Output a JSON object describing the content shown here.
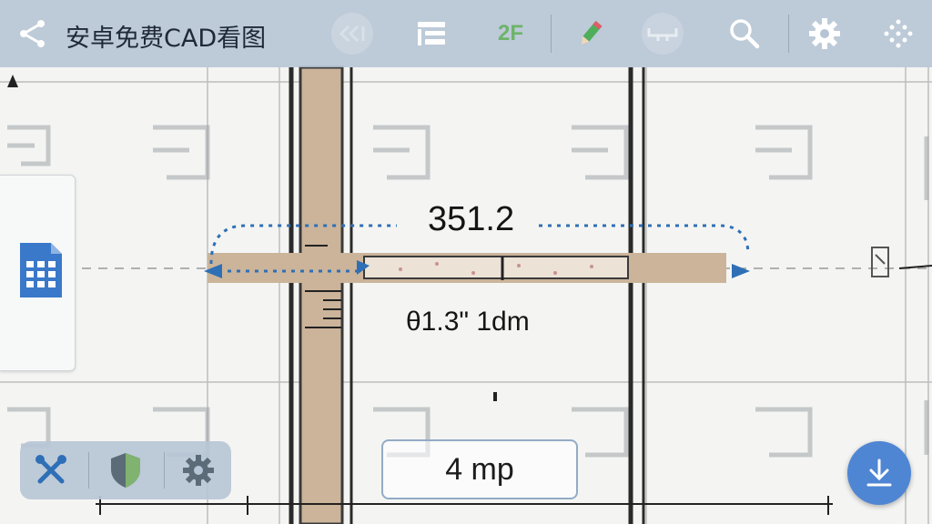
{
  "app": {
    "title": "安卓免费CAD看图"
  },
  "toolbar": {
    "icons": [
      "back-share-icon",
      "rewind-icon",
      "layer-list-icon",
      "floor-2f-icon",
      "pencil-icon",
      "measure-icon",
      "search-icon",
      "gear-icon",
      "more-dots-icon"
    ],
    "floor_label": "2F"
  },
  "drawing": {
    "dimension_main": "351.2",
    "dimension_sub": "θ1.3\" 1dm"
  },
  "bottom_tools": {
    "icons": [
      "tools-icon",
      "shield-icon",
      "gear-icon"
    ],
    "scale_label": "4 mp"
  },
  "colors": {
    "toolbar": "#b5c4d4",
    "accent_blue": "#2f6fb6",
    "fab": "#4f86d4",
    "wall": "#cbb49a"
  }
}
